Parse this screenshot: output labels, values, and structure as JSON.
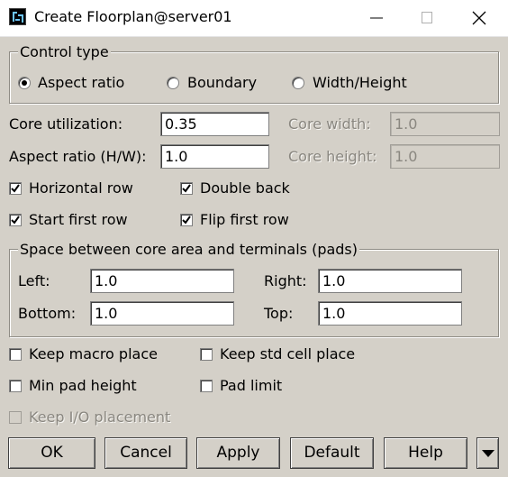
{
  "window": {
    "title": "Create Floorplan@server01"
  },
  "control_type": {
    "legend": "Control type",
    "options": [
      {
        "label": "Aspect ratio",
        "selected": true
      },
      {
        "label": "Boundary",
        "selected": false
      },
      {
        "label": "Width/Height",
        "selected": false
      }
    ]
  },
  "core": {
    "utilization_label": "Core utilization:",
    "utilization_value": "0.35",
    "aspect_label": "Aspect ratio (H/W):",
    "aspect_value": "1.0",
    "width_label": "Core width:",
    "width_value": "1.0",
    "height_label": "Core height:",
    "height_value": "1.0"
  },
  "row_options": {
    "horizontal_row": {
      "label": "Horizontal row",
      "checked": true
    },
    "double_back": {
      "label": "Double back",
      "checked": true
    },
    "start_first_row": {
      "label": "Start first row",
      "checked": true
    },
    "flip_first_row": {
      "label": "Flip first row",
      "checked": true
    }
  },
  "spacing": {
    "legend": "Space between core area and terminals (pads)",
    "left_label": "Left:",
    "left_value": "1.0",
    "right_label": "Right:",
    "right_value": "1.0",
    "bottom_label": "Bottom:",
    "bottom_value": "1.0",
    "top_label": "Top:",
    "top_value": "1.0"
  },
  "placement": {
    "keep_macro_place": {
      "label": "Keep macro place",
      "checked": false
    },
    "keep_std_cell_place": {
      "label": "Keep std cell place",
      "checked": false
    },
    "min_pad_height": {
      "label": "Min pad height",
      "checked": false
    },
    "pad_limit": {
      "label": "Pad limit",
      "checked": false
    },
    "keep_io_placement": {
      "label": "Keep I/O placement",
      "checked": false,
      "disabled": true
    }
  },
  "buttons": {
    "ok": "OK",
    "cancel": "Cancel",
    "apply": "Apply",
    "default": "Default",
    "help": "Help"
  }
}
